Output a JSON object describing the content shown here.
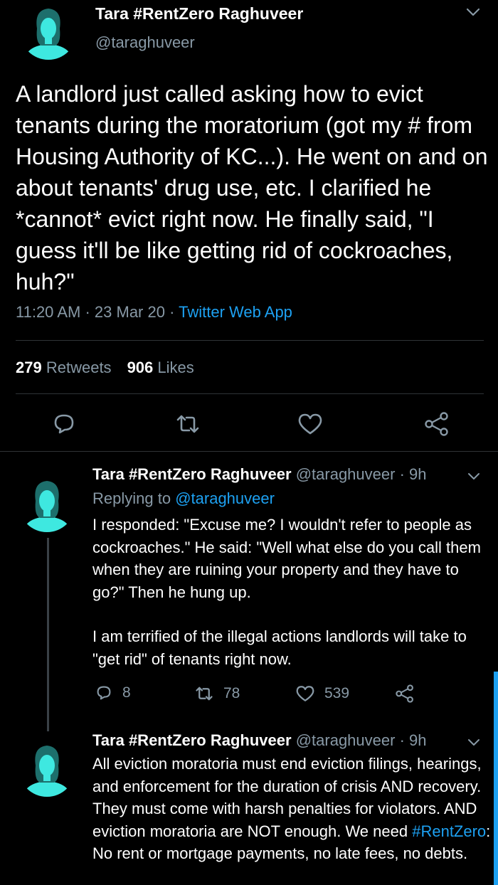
{
  "main_tweet": {
    "name": "Tara #RentZero Raghuveer",
    "handle": "@taraghuveer",
    "text": "A landlord just called asking how to evict tenants during the moratorium (got my # from Housing Authority of KC...). He went on and on about tenants' drug use, etc. I clarified he *cannot* evict right now. He finally said, \"I guess it'll be like getting rid of cockroaches, huh?\"",
    "time": "11:20 AM",
    "date": "23 Mar 20",
    "source": "Twitter Web App",
    "retweets_count": "279",
    "retweets_label": "Retweets",
    "likes_count": "906",
    "likes_label": "Likes"
  },
  "reply1": {
    "name": "Tara #RentZero Raghuveer",
    "handle": "@taraghuveer",
    "age": "9h",
    "replying_prefix": "Replying to",
    "replying_handle": "@taraghuveer",
    "para1": "I responded: \"Excuse me? I wouldn't refer to people as cockroaches.\" He said: \"Well what else do you call them when they are ruining your property and they have to go?\" Then he hung up.",
    "para2": "I am terrified of the illegal actions landlords will take to \"get rid\" of tenants right now.",
    "reply_count": "8",
    "retweet_count": "78",
    "like_count": "539"
  },
  "reply2": {
    "name": "Tara #RentZero Raghuveer",
    "handle": "@taraghuveer",
    "age": "9h",
    "text_before": "All eviction moratoria must end eviction filings, hearings, and enforcement for the duration of crisis AND recovery. They must come with harsh penalties for violators. AND eviction moratoria are NOT enough. We need ",
    "hashtag": "#RentZero",
    "text_after": ": No rent or mortgage payments, no late fees, no debts."
  },
  "colors": {
    "background": "#000000",
    "text": "#ffffff",
    "secondary": "#8899a6",
    "link": "#1da1f2",
    "divider": "#2f3336",
    "avatar_tint": "#3ee8e0"
  },
  "icons": [
    "chevron-down-icon",
    "reply-icon",
    "retweet-icon",
    "like-icon",
    "share-icon"
  ]
}
